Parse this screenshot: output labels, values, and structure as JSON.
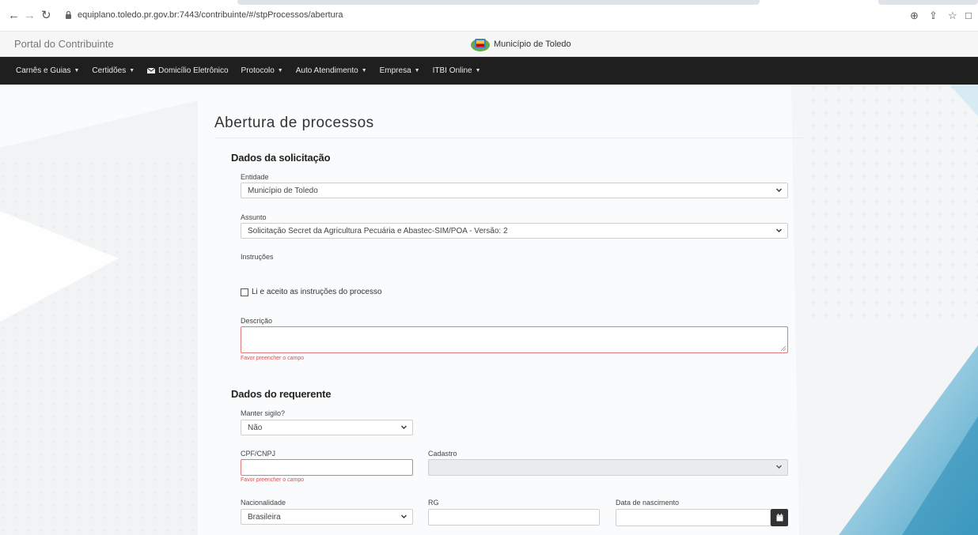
{
  "browser": {
    "url": "equiplano.toledo.pr.gov.br:7443/contribuinte/#/stpProcessos/abertura"
  },
  "portal": {
    "title": "Portal do Contribuinte",
    "brand": "Município de Toledo"
  },
  "nav": {
    "items": [
      {
        "label": "Carnês e Guias",
        "dropdown": true
      },
      {
        "label": "Certidões",
        "dropdown": true
      },
      {
        "label": "Domicílio Eletrônico",
        "dropdown": false
      },
      {
        "label": "Protocolo",
        "dropdown": true
      },
      {
        "label": "Auto Atendimento",
        "dropdown": true
      },
      {
        "label": "Empresa",
        "dropdown": true
      },
      {
        "label": "ITBI Online",
        "dropdown": true
      }
    ]
  },
  "form": {
    "title": "Abertura de processos",
    "solicitacao": {
      "section_title": "Dados da solicitação",
      "entidade_label": "Entidade",
      "entidade_value": "Município de Toledo",
      "assunto_label": "Assunto",
      "assunto_value": "Solicitação Secret da Agricultura Pecuária e Abastec-SIM/POA - Versão: 2",
      "instrucoes_label": "Instruções",
      "accept_label": "Li e aceito as instruções do processo",
      "descricao_label": "Descrição",
      "descricao_error": "Favor preencher o campo"
    },
    "requerente": {
      "section_title": "Dados do requerente",
      "sigilo_label": "Manter sigilo?",
      "sigilo_value": "Não",
      "cpf_label": "CPF/CNPJ",
      "cpf_error": "Favor preencher o campo",
      "cadastro_label": "Cadastro",
      "nacionalidade_label": "Nacionalidade",
      "nacionalidade_value": "Brasileira",
      "rg_label": "RG",
      "nascimento_label": "Data de nascimento"
    }
  },
  "colors": {
    "navbar": "#1f1f1f",
    "error": "#d9534f",
    "accent_bg": "#4ba3c7"
  }
}
